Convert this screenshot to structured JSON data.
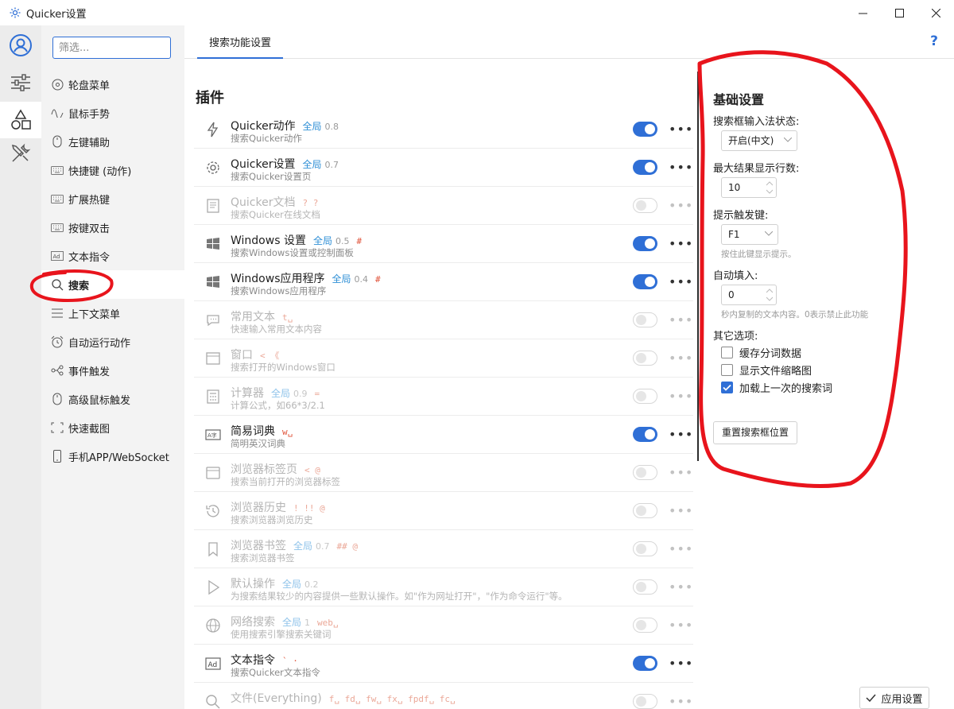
{
  "window": {
    "title": "Quicker设置"
  },
  "rail": {
    "items": [
      {
        "name": "account",
        "icon": "user-circle-icon"
      },
      {
        "name": "sliders",
        "icon": "sliders-icon"
      },
      {
        "name": "shapes",
        "icon": "shapes-icon",
        "active": true
      },
      {
        "name": "tools",
        "icon": "tools-icon"
      }
    ]
  },
  "nav": {
    "filter_placeholder": "筛选...",
    "items": [
      {
        "label": "轮盘菜单",
        "icon": "wheel-icon"
      },
      {
        "label": "鼠标手势",
        "icon": "gesture-icon"
      },
      {
        "label": "左键辅助",
        "icon": "mouse-icon"
      },
      {
        "label": "快捷键 (动作)",
        "icon": "keyboard-icon"
      },
      {
        "label": "扩展热键",
        "icon": "keyboard-icon"
      },
      {
        "label": "按键双击",
        "icon": "keyboard-icon"
      },
      {
        "label": "文本指令",
        "icon": "text-ad-icon"
      },
      {
        "label": "搜索",
        "icon": "search-icon",
        "active": true
      },
      {
        "label": "上下文菜单",
        "icon": "menu-icon"
      },
      {
        "label": "自动运行动作",
        "icon": "alarm-icon"
      },
      {
        "label": "事件触发",
        "icon": "event-icon"
      },
      {
        "label": "高级鼠标触发",
        "icon": "mouse-icon"
      },
      {
        "label": "快速截图",
        "icon": "screenshot-icon"
      },
      {
        "label": "手机APP/WebSocket",
        "icon": "phone-icon"
      }
    ]
  },
  "main": {
    "tab_label": "搜索功能设置",
    "help_label": "?",
    "section_title": "插件",
    "plugins": [
      {
        "name": "Quicker动作",
        "scope": "全局",
        "version": "0.8",
        "keywords": "",
        "desc": "搜索Quicker动作",
        "enabled": true,
        "icon": "lightning-icon"
      },
      {
        "name": "Quicker设置",
        "scope": "全局",
        "version": "0.7",
        "keywords": "",
        "desc": "搜索Quicker设置页",
        "enabled": true,
        "icon": "gear-icon"
      },
      {
        "name": "Quicker文档",
        "scope": "",
        "version": "",
        "keywords": "? ?",
        "desc": "搜索Quicker在线文档",
        "enabled": false,
        "icon": "book-icon"
      },
      {
        "name": "Windows 设置",
        "scope": "全局",
        "version": "0.5",
        "keywords": "#",
        "desc": "搜索Windows设置或控制面板",
        "enabled": true,
        "icon": "windows-icon"
      },
      {
        "name": "Windows应用程序",
        "scope": "全局",
        "version": "0.4",
        "keywords": "#",
        "desc": "搜索Windows应用程序",
        "enabled": true,
        "icon": "windows-icon"
      },
      {
        "name": "常用文本",
        "scope": "",
        "version": "",
        "keywords": "t␣",
        "desc": "快速输入常用文本内容",
        "enabled": false,
        "icon": "chat-icon"
      },
      {
        "name": "窗口",
        "scope": "",
        "version": "",
        "keywords": "< 《",
        "desc": "搜索打开的Windows窗口",
        "enabled": false,
        "icon": "window-icon"
      },
      {
        "name": "计算器",
        "scope": "全局",
        "version": "0.9",
        "keywords": "=",
        "desc": "计算公式，如66*3/2.1",
        "enabled": false,
        "icon": "calculator-icon"
      },
      {
        "name": "简易词典",
        "scope": "",
        "version": "",
        "keywords": "w␣",
        "desc": "简明英汉词典",
        "enabled": true,
        "icon": "dictionary-icon"
      },
      {
        "name": "浏览器标签页",
        "scope": "",
        "version": "",
        "keywords": "< @",
        "desc": "搜索当前打开的浏览器标签",
        "enabled": false,
        "icon": "browser-tab-icon"
      },
      {
        "name": "浏览器历史",
        "scope": "",
        "version": "",
        "keywords": "! !! @",
        "desc": "搜索浏览器浏览历史",
        "enabled": false,
        "icon": "history-icon"
      },
      {
        "name": "浏览器书签",
        "scope": "全局",
        "version": "0.7",
        "keywords": "## @",
        "desc": "搜索浏览器书签",
        "enabled": false,
        "icon": "bookmark-icon"
      },
      {
        "name": "默认操作",
        "scope": "全局",
        "version": "0.2",
        "keywords": "",
        "desc": "为搜索结果较少的内容提供一些默认操作。如\"作为网址打开\"，\"作为命令运行\"等。",
        "enabled": false,
        "icon": "play-icon"
      },
      {
        "name": "网络搜索",
        "scope": "全局",
        "version": "1",
        "keywords": "web␣",
        "desc": "使用搜索引擎搜索关键词",
        "enabled": false,
        "icon": "globe-icon"
      },
      {
        "name": "文本指令",
        "scope": "",
        "version": "",
        "keywords": "` ·",
        "desc": "搜索Quicker文本指令",
        "enabled": true,
        "icon": "text-ad-icon"
      },
      {
        "name": "文件(Everything)",
        "scope": "",
        "version": "",
        "keywords": "f␣ fd␣ fw␣ fx␣ fpdf␣ fc␣",
        "desc": "",
        "enabled": false,
        "icon": "search-icon"
      }
    ]
  },
  "settings": {
    "title": "基础设置",
    "ime_label": "搜索框输入法状态:",
    "ime_value": "开启(中文)",
    "max_rows_label": "最大结果显示行数:",
    "max_rows_value": "10",
    "hint_key_label": "提示触发键:",
    "hint_key_value": "F1",
    "hint_key_desc": "按住此键显示提示。",
    "autofill_label": "自动填入:",
    "autofill_value": "0",
    "autofill_desc": "秒内复制的文本内容。0表示禁止此功能",
    "other_label": "其它选项:",
    "options": [
      {
        "label": "缓存分词数据",
        "checked": false
      },
      {
        "label": "显示文件缩略图",
        "checked": false
      },
      {
        "label": "加载上一次的搜索词",
        "checked": true
      }
    ],
    "reset_button": "重置搜索框位置"
  },
  "footer": {
    "apply_button": "应用设置"
  },
  "colors": {
    "accent": "#2f6fd6",
    "annotation": "#e8141c",
    "keyword": "#e0533a",
    "scope": "#2f8fd6"
  }
}
